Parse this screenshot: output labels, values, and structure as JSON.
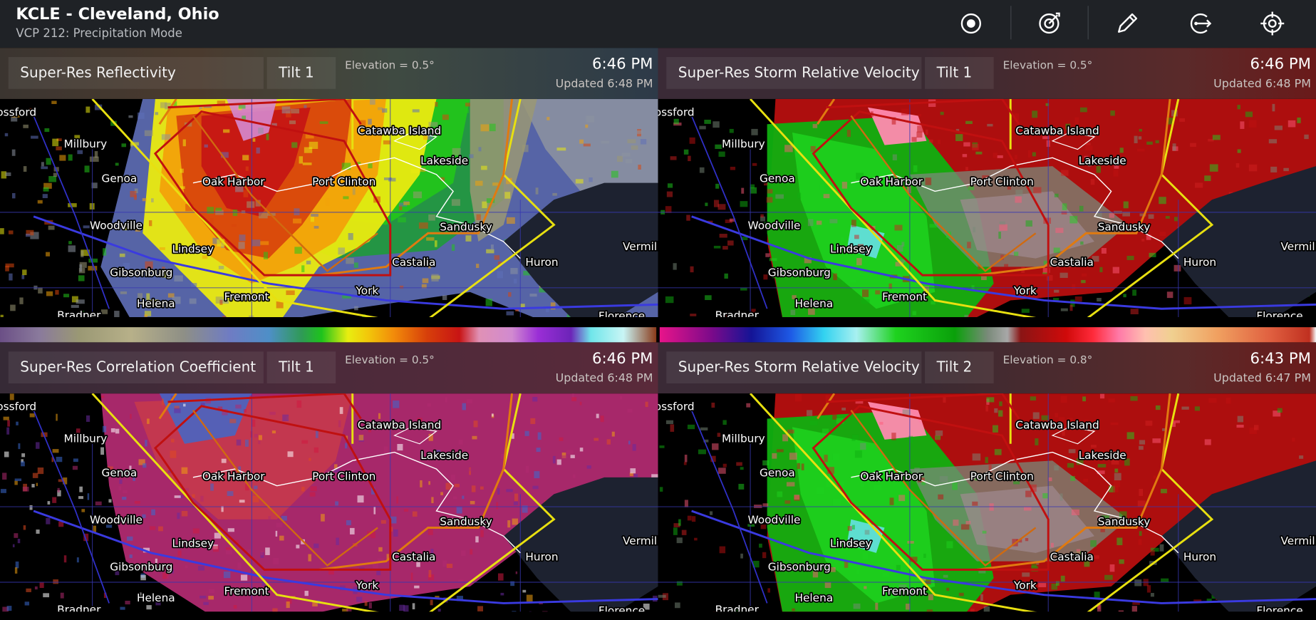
{
  "header": {
    "title": "KCLE - Cleveland, Ohio",
    "subtitle": "VCP 212: Precipitation Mode",
    "icons": [
      "record-icon",
      "radar-sweep-icon",
      "pencil-icon",
      "exit-arrow-icon",
      "crosshair-icon"
    ]
  },
  "panels": [
    {
      "product": "Super-Res Reflectivity",
      "tilt": "Tilt 1",
      "elevation": "Elevation = 0.5°",
      "time": "6:46 PM",
      "updated": "Updated 6:48 PM",
      "product_type": "reflectivity"
    },
    {
      "product": "Super-Res Storm Relative Velocity",
      "tilt": "Tilt 1",
      "elevation": "Elevation = 0.5°",
      "time": "6:46 PM",
      "updated": "Updated 6:48 PM",
      "product_type": "velocity"
    },
    {
      "product": "Super-Res Correlation Coefficient",
      "tilt": "Tilt 1",
      "elevation": "Elevation = 0.5°",
      "time": "6:46 PM",
      "updated": "Updated 6:48 PM",
      "product_type": "correlation"
    },
    {
      "product": "Super-Res Storm Relative Velocity",
      "tilt": "Tilt 2",
      "elevation": "Elevation = 0.8°",
      "time": "6:43 PM",
      "updated": "Updated 6:47 PM",
      "product_type": "velocity"
    }
  ],
  "map_labels": [
    "ossford",
    "Millbury",
    "Genoa",
    "Oak Harbor",
    "Port Clinton",
    "Catawba Island",
    "Lakeside",
    "Sandusky",
    "Woodville",
    "Lindsey",
    "Gibsonburg",
    "Castalia",
    "Huron",
    "Vermili",
    "Helena",
    "Fremont",
    "York",
    "Bradner",
    "Florence"
  ],
  "colors": {
    "topbar": "#1f2226",
    "warning_red": "#d01010",
    "watch_yellow": "#e8e010",
    "warning_orange": "#e07a10",
    "road_blue": "#3030c8"
  }
}
